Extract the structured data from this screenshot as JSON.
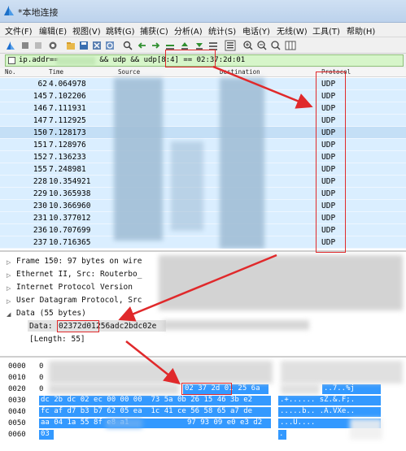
{
  "window": {
    "title": "*本地连接"
  },
  "menu": [
    "文件(F)",
    "编辑(E)",
    "视图(V)",
    "跳转(G)",
    "捕获(C)",
    "分析(A)",
    "统计(S)",
    "电话(Y)",
    "无线(W)",
    "工具(T)",
    "帮助(H)"
  ],
  "toolbar": {
    "icons": [
      "shark-fin-start-icon",
      "stop-icon",
      "restart-icon",
      "options-icon",
      "open-file-icon",
      "save-icon",
      "close-file-icon",
      "reload-icon",
      "find-icon",
      "back-icon",
      "forward-icon",
      "go-to-icon",
      "first-icon",
      "last-icon",
      "autoscroll-icon",
      "colorize-icon",
      "zoom-in-icon",
      "zoom-out-icon",
      "normal-size-icon",
      "resize-columns-icon"
    ]
  },
  "filter": {
    "prefix": "ip.addr==",
    "rest": " && udp && udp[8:4] == 02:37:2d:01"
  },
  "packet_list": {
    "columns": {
      "no": "No.",
      "time": "Time",
      "source": "Source",
      "destination": "Destination",
      "protocol": "Protocol"
    },
    "rows": [
      {
        "no": "62",
        "time": "4.064978",
        "protocol": "UDP"
      },
      {
        "no": "145",
        "time": "7.102206",
        "protocol": "UDP"
      },
      {
        "no": "146",
        "time": "7.111931",
        "protocol": "UDP"
      },
      {
        "no": "147",
        "time": "7.112925",
        "protocol": "UDP"
      },
      {
        "no": "150",
        "time": "7.128173",
        "protocol": "UDP"
      },
      {
        "no": "151",
        "time": "7.128976",
        "protocol": "UDP"
      },
      {
        "no": "152",
        "time": "7.136233",
        "protocol": "UDP"
      },
      {
        "no": "155",
        "time": "7.248981",
        "protocol": "UDP"
      },
      {
        "no": "228",
        "time": "10.354921",
        "protocol": "UDP"
      },
      {
        "no": "229",
        "time": "10.365938",
        "protocol": "UDP"
      },
      {
        "no": "230",
        "time": "10.366960",
        "protocol": "UDP"
      },
      {
        "no": "231",
        "time": "10.377012",
        "protocol": "UDP"
      },
      {
        "no": "236",
        "time": "10.707699",
        "protocol": "UDP"
      },
      {
        "no": "237",
        "time": "10.716365",
        "protocol": "UDP"
      }
    ]
  },
  "details": {
    "frame": "Frame 150: 97 bytes on wire",
    "ethernet": "Ethernet II, Src: Routerbo_",
    "ip": "Internet Protocol Version",
    "udp": "User Datagram Protocol, Src",
    "data": "Data (55 bytes)",
    "data_value_label": "Data: ",
    "data_value_hl": "02372d01",
    "data_value_rest": "256adc2bdc02e",
    "length": "[Length: 55]"
  },
  "hex": {
    "offsets": [
      "0000",
      "0010",
      "0020",
      "0030",
      "0040",
      "0050",
      "0060"
    ],
    "row0": "0",
    "row1": "0",
    "row2_start": "0",
    "row2_hl": "02 37 2d 01",
    "row2_rest": " 25 6a",
    "row3": "dc 2b dc 02 ec 00 00 00  73 5a 0b 26 15 46 3b e2",
    "row4": "fc af d7 b3 b7 62 05 ea  1c 41 ce 56 58 65 a7 de",
    "row5": "aa 04 1a 55 8f e8 a1",
    "row5_rest": "97 93 09 e0 e3 d2",
    "row6": "03",
    "ascii2": "..7..%j",
    "ascii3": ".+...... sZ.&.F;.",
    "ascii4": ".....b.. .A.VXe..",
    "ascii5": "...U....",
    "ascii6": "."
  },
  "colors": {
    "row": "#daeeff",
    "selected_row": "#c4dff6",
    "filter_ok": "#d6f5c9",
    "hex_selection": "#3399ff",
    "annotation": "#e0292b"
  }
}
